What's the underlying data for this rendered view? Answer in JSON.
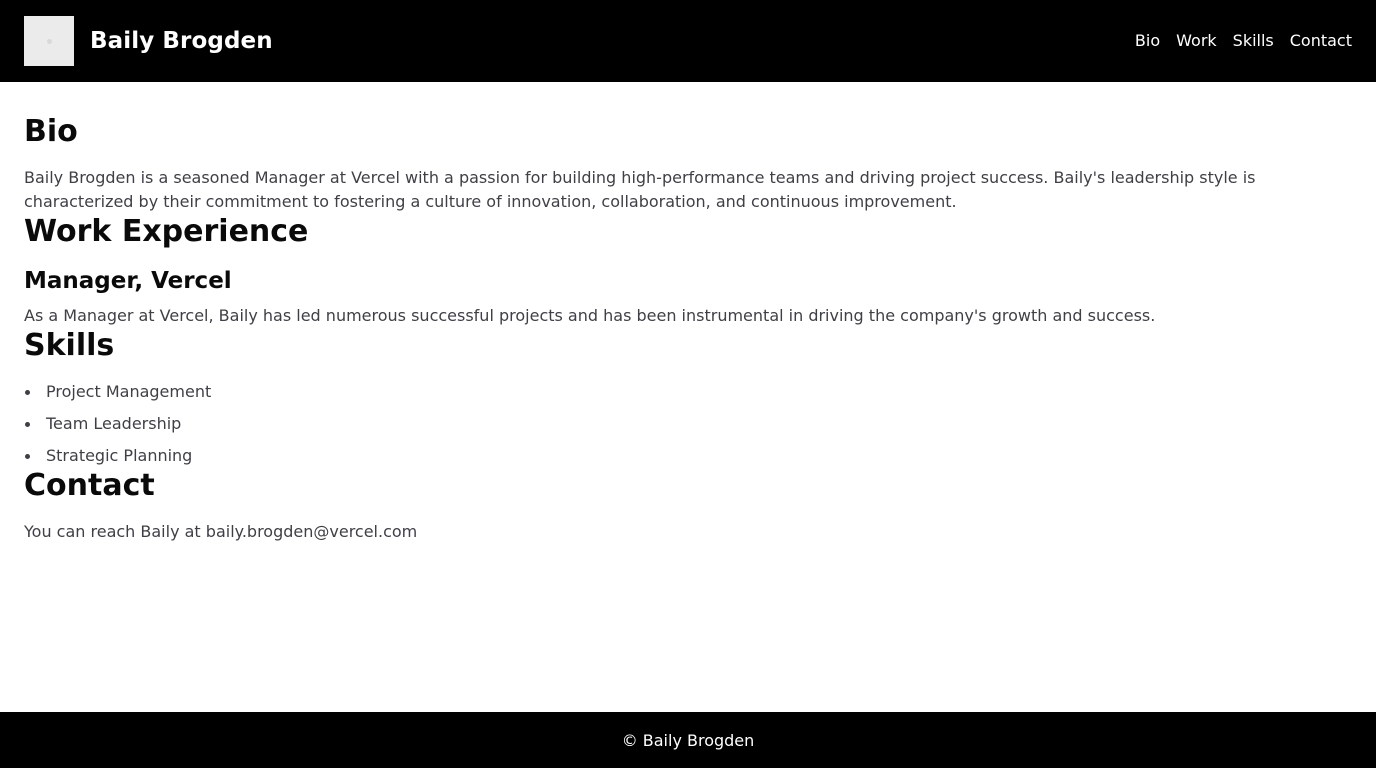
{
  "header": {
    "title": "Baily Brogden",
    "nav": [
      "Bio",
      "Work",
      "Skills",
      "Contact"
    ]
  },
  "bio": {
    "heading": "Bio",
    "text": "Baily Brogden is a seasoned Manager at Vercel with a passion for building high-performance teams and driving project success. Baily's leadership style is characterized by their commitment to fostering a culture of innovation, collaboration, and continuous improvement."
  },
  "work": {
    "heading": "Work Experience",
    "job_title": "Manager, Vercel",
    "job_text": "As a Manager at Vercel, Baily has led numerous successful projects and has been instrumental in driving the company's growth and success."
  },
  "skills": {
    "heading": "Skills",
    "items": [
      "Project Management",
      "Team Leadership",
      "Strategic Planning"
    ]
  },
  "contact": {
    "heading": "Contact",
    "text": "You can reach Baily at baily.brogden@vercel.com"
  },
  "footer": {
    "text": "© Baily Brogden"
  }
}
